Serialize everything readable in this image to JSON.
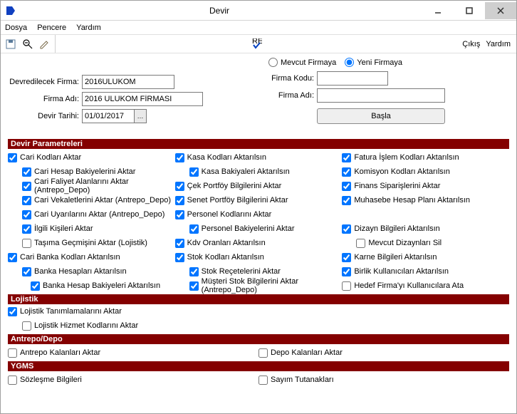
{
  "window": {
    "title": "Devir"
  },
  "menubar": {
    "file": "Dosya",
    "window": "Pencere",
    "help": "Yardım"
  },
  "toolbar": {
    "exit": "Çıkış",
    "help": "Yardım"
  },
  "form": {
    "firm_label": "Devredilecek Firma:",
    "firm_value": "2016ULUKOM",
    "firm_name_label": "Firma Adı:",
    "firm_name_value": "2016 ULUKOM FİRMASI",
    "date_label": "Devir Tarihi:",
    "date_value": "01/01/2017",
    "radio_existing": "Mevcut Firmaya",
    "radio_new": "Yeni Firmaya",
    "code_label": "Firma Kodu:",
    "code_value": "",
    "name2_label": "Firma Adı:",
    "name2_value": "",
    "start": "Başla"
  },
  "sections": {
    "params": "Devir Parametreleri",
    "logistics": "Lojistik",
    "warehouse": "Antrepo/Depo",
    "ygms": "YGMS"
  },
  "params": {
    "col1": [
      {
        "label": "Cari Kodları Aktar",
        "checked": true,
        "indent": 0
      },
      {
        "label": "Cari Hesap Bakiyelerini Aktar",
        "checked": true,
        "indent": 1
      },
      {
        "label": "Cari Faliyet Alanlarını Aktar (Antrepo_Depo)",
        "checked": true,
        "indent": 1
      },
      {
        "label": "Cari Vekaletlerini Aktar (Antrepo_Depo)",
        "checked": true,
        "indent": 1
      },
      {
        "label": "Cari Uyarılarını Aktar (Antrepo_Depo)",
        "checked": true,
        "indent": 1
      },
      {
        "label": "İlgili Kişileri Aktar",
        "checked": true,
        "indent": 1
      },
      {
        "label": "Taşıma Geçmişini Aktar (Lojistik)",
        "checked": false,
        "indent": 1
      },
      {
        "label": "Cari Banka Kodları Aktarılsın",
        "checked": true,
        "indent": 0
      },
      {
        "label": "Banka Hesapları Aktarılsın",
        "checked": true,
        "indent": 1
      },
      {
        "label": "Banka Hesap Bakiyeleri Aktarılsın",
        "checked": true,
        "indent": 2
      }
    ],
    "col2": [
      {
        "label": "Kasa Kodları Aktarılsın",
        "checked": true
      },
      {
        "label": "Kasa Bakiyaleri Aktarılsın",
        "checked": true,
        "indent": 1
      },
      {
        "label": "Çek Portföy Bilgilerini Aktar",
        "checked": true
      },
      {
        "label": "Senet Portföy Bilgilerini Aktar",
        "checked": true
      },
      {
        "label": "Personel Kodlarını Aktar",
        "checked": true
      },
      {
        "label": "Personel Bakiyelerini Aktar",
        "checked": true,
        "indent": 1
      },
      {
        "label": "Kdv Oranları Aktarılsın",
        "checked": true
      },
      {
        "label": "Stok Kodları Aktarılsın",
        "checked": true
      },
      {
        "label": "Stok Reçetelerini Aktar",
        "checked": true,
        "indent": 1
      },
      {
        "label": "Müşteri Stok Bilgilerini Aktar (Antrepo_Depo)",
        "checked": true,
        "indent": 1
      }
    ],
    "col3": [
      {
        "label": "Fatura İşlem Kodları Aktarılsın",
        "checked": true
      },
      {
        "label": "Komisyon Kodları Aktarılsın",
        "checked": true
      },
      {
        "label": "Finans Siparişlerini Aktar",
        "checked": true
      },
      {
        "label": "Muhasebe Hesap Planı Aktarılsın",
        "checked": true
      },
      {
        "label": "",
        "spacer": true
      },
      {
        "label": "Dizayn Bilgileri Aktarılsın",
        "checked": true
      },
      {
        "label": "Mevcut Dizaynları Sil",
        "checked": false,
        "indent": 1
      },
      {
        "label": "Karne Bilgileri Aktarılsın",
        "checked": true
      },
      {
        "label": "Birlik Kullanıcıları Aktarılsın",
        "checked": true
      },
      {
        "label": "Hedef Firma'yı Kullanıcılara Ata",
        "checked": false
      }
    ]
  },
  "logistics": [
    {
      "label": "Lojistik Tanımlamalarını Aktar",
      "checked": true,
      "indent": 0
    },
    {
      "label": "Lojistik Hizmet Kodlarını Aktar",
      "checked": false,
      "indent": 1
    }
  ],
  "warehouse": {
    "left": {
      "label": "Antrepo Kalanları Aktar",
      "checked": false
    },
    "right": {
      "label": "Depo Kalanları Aktar",
      "checked": false
    }
  },
  "ygms": {
    "left": {
      "label": "Sözleşme Bilgileri",
      "checked": false
    },
    "right": {
      "label": "Sayım Tutanakları",
      "checked": false
    }
  }
}
